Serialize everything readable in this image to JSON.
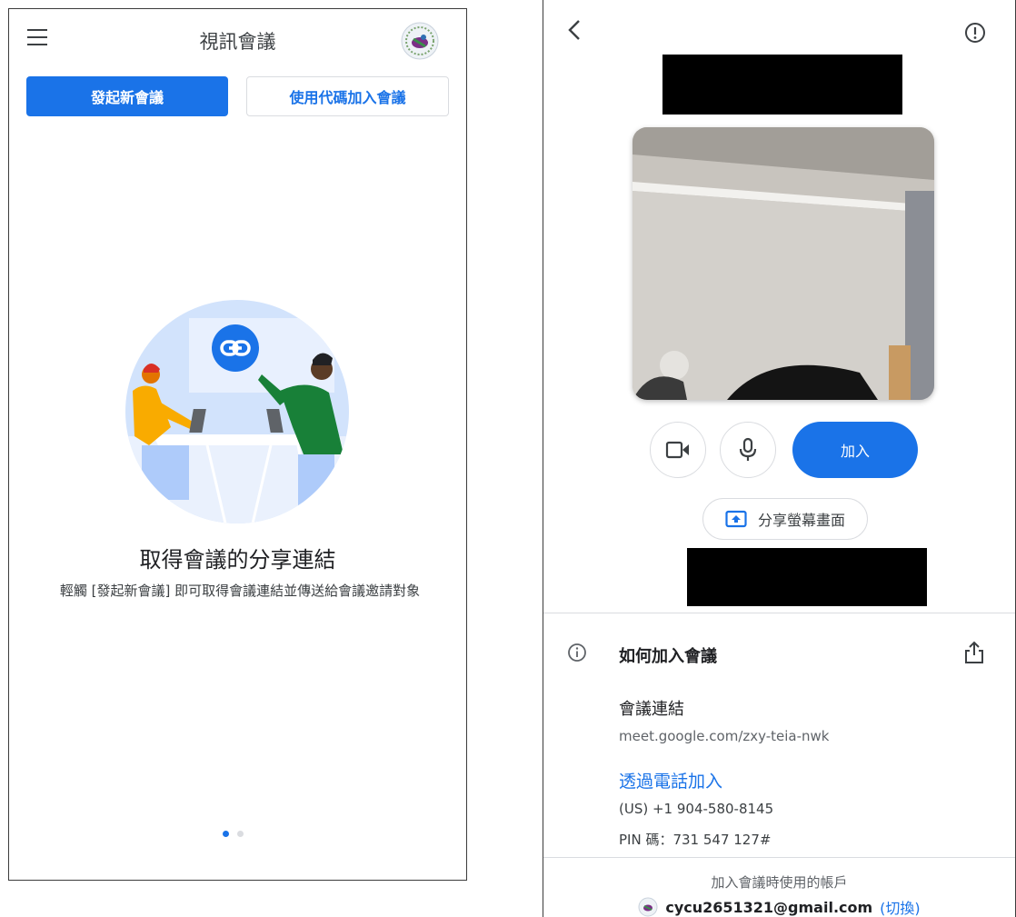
{
  "left": {
    "title": "視訊會議",
    "new_meeting_label": "發起新會議",
    "join_code_label": "使用代碼加入會議",
    "headline": "取得會議的分享連結",
    "description": "輕觸 [發起新會議] 即可取得會議連結並傳送給會議邀請對象",
    "page_indicator": {
      "current": 1,
      "total": 2
    }
  },
  "right": {
    "join_label": "加入",
    "share_screen_label": "分享螢幕畫面",
    "how_to_join": "如何加入會議",
    "meeting_link_label": "會議連結",
    "meeting_link": "meet.google.com/zxy-teia-nwk",
    "join_by_phone": "透過電話加入",
    "phone_number": "(US) +1 904-580-8145",
    "pin": "PIN 碼：731 547 127#",
    "account_note": "加入會議時使用的帳戶",
    "account_email": "cycu2651321@gmail.com",
    "switch_label": "(切換)"
  },
  "icons": [
    "menu-icon",
    "avatar-logo-icon",
    "link-icon",
    "back-icon",
    "report-issue-icon",
    "camera-icon",
    "microphone-icon",
    "present-screen-icon",
    "info-icon",
    "share-icon"
  ],
  "colors": {
    "primary": "#1a73e8",
    "text": "#202124",
    "secondary_text": "#5f6368",
    "border": "#dadce0"
  }
}
